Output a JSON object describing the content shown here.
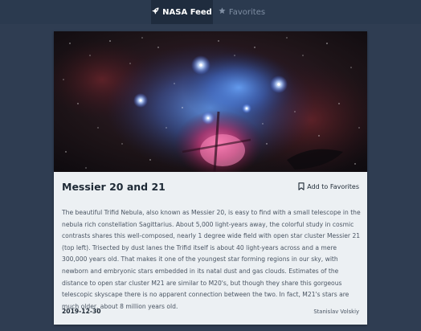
{
  "nav": {
    "tabs": [
      {
        "label": "NASA Feed",
        "icon": "rocket-icon",
        "active": true
      },
      {
        "label": "Favorites",
        "icon": "star-icon",
        "active": false
      }
    ]
  },
  "colors": {
    "page_background": "#2f3d52",
    "nav_background": "#2b3a4f",
    "nav_active": "#1f2c3e",
    "card_background": "#ecf0f3"
  },
  "card": {
    "image_description_icon": "nebula-image",
    "title": "Messier 20 and 21",
    "favorite_label": "Add to Favorites",
    "favorite_icon": "bookmark-icon",
    "explanation": "The beautiful Trifid Nebula, also known as Messier 20, is easy to find with a small telescope in the nebula rich constellation Sagittarius. About 5,000 light-years away, the colorful study in cosmic contrasts shares this well-composed, nearly 1 degree wide field with open star cluster Messier 21 (top left). Trisected by dust lanes the Trifid itself is about 40 light-years across and a mere 300,000 years old. That makes it one of the youngest star forming regions in our sky, with newborn and embryonic stars embedded in its natal dust and gas clouds. Estimates of the distance to open star cluster M21 are similar to M20's, but though they share this gorgeous telescopic skyscape there is no apparent connection between the two. In fact, M21's stars are much older, about 8 million years old.",
    "date": "2019-12-30",
    "author": "Stanislav Volskiy"
  }
}
